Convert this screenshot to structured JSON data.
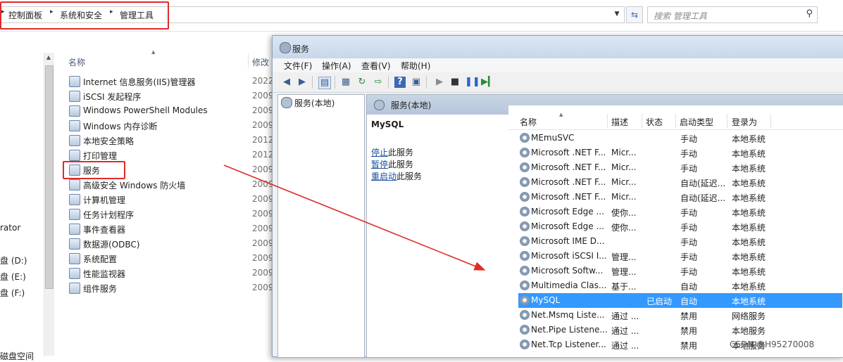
{
  "explorer": {
    "breadcrumbs": [
      "控制面板",
      "系统和安全",
      "管理工具"
    ],
    "search_placeholder": "搜索 管理工具",
    "left_nav": [
      "rator",
      "盘 (D:)",
      "盘 (E:)",
      "盘 (F:)",
      "磁盘空间"
    ],
    "columns": {
      "name": "名称",
      "modified": "修改"
    },
    "files": [
      {
        "name": "Internet 信息服务(IIS)管理器",
        "date": "2022"
      },
      {
        "name": "iSCSI 发起程序",
        "date": "2009"
      },
      {
        "name": "Windows PowerShell Modules",
        "date": "2009"
      },
      {
        "name": "Windows 内存诊断",
        "date": "2009"
      },
      {
        "name": "本地安全策略",
        "date": "2012"
      },
      {
        "name": "打印管理",
        "date": "2012"
      },
      {
        "name": "服务",
        "date": "2009"
      },
      {
        "name": "高级安全 Windows 防火墙",
        "date": "2009"
      },
      {
        "name": "计算机管理",
        "date": "2009"
      },
      {
        "name": "任务计划程序",
        "date": "2009"
      },
      {
        "name": "事件查看器",
        "date": "2009"
      },
      {
        "name": "数据源(ODBC)",
        "date": "2009"
      },
      {
        "name": "系统配置",
        "date": "2009"
      },
      {
        "name": "性能监视器",
        "date": "2009"
      },
      {
        "name": "组件服务",
        "date": "2009"
      }
    ]
  },
  "services_window": {
    "title": "服务",
    "menu": [
      "文件(F)",
      "操作(A)",
      "查看(V)",
      "帮助(H)"
    ],
    "tree_item": "服务(本地)",
    "pane_title": "服务(本地)",
    "selected_service": "MySQL",
    "actions": [
      {
        "link": "停止",
        "rest": "此服务"
      },
      {
        "link": "暂停",
        "rest": "此服务"
      },
      {
        "link": "重启动",
        "rest": "此服务"
      }
    ],
    "columns": {
      "name": "名称",
      "desc": "描述",
      "status": "状态",
      "startup": "启动类型",
      "logon": "登录为"
    },
    "rows": [
      {
        "name": "MEmuSVC",
        "desc": "",
        "status": "",
        "startup": "手动",
        "logon": "本地系统"
      },
      {
        "name": "Microsoft .NET F...",
        "desc": "Micr...",
        "status": "",
        "startup": "手动",
        "logon": "本地系统"
      },
      {
        "name": "Microsoft .NET F...",
        "desc": "Micr...",
        "status": "",
        "startup": "手动",
        "logon": "本地系统"
      },
      {
        "name": "Microsoft .NET F...",
        "desc": "Micr...",
        "status": "",
        "startup": "自动(延迟...",
        "logon": "本地系统"
      },
      {
        "name": "Microsoft .NET F...",
        "desc": "Micr...",
        "status": "",
        "startup": "自动(延迟...",
        "logon": "本地系统"
      },
      {
        "name": "Microsoft Edge ...",
        "desc": "使你...",
        "status": "",
        "startup": "手动",
        "logon": "本地系统"
      },
      {
        "name": "Microsoft Edge ...",
        "desc": "使你...",
        "status": "",
        "startup": "手动",
        "logon": "本地系统"
      },
      {
        "name": "Microsoft IME D...",
        "desc": "",
        "status": "",
        "startup": "手动",
        "logon": "本地系统"
      },
      {
        "name": "Microsoft iSCSI I...",
        "desc": "管理...",
        "status": "",
        "startup": "手动",
        "logon": "本地系统"
      },
      {
        "name": "Microsoft Softw...",
        "desc": "管理...",
        "status": "",
        "startup": "手动",
        "logon": "本地系统"
      },
      {
        "name": "Multimedia Clas...",
        "desc": "基于...",
        "status": "",
        "startup": "自动",
        "logon": "本地系统"
      },
      {
        "name": "MySQL",
        "desc": "",
        "status": "已启动",
        "startup": "自动",
        "logon": "本地系统"
      },
      {
        "name": "Net.Msmq Liste...",
        "desc": "通过 ...",
        "status": "",
        "startup": "禁用",
        "logon": "网络服务"
      },
      {
        "name": "Net.Pipe Listene...",
        "desc": "通过 ...",
        "status": "",
        "startup": "禁用",
        "logon": "本地服务"
      },
      {
        "name": "Net.Tcp Listener...",
        "desc": "通过 ...",
        "status": "",
        "startup": "禁用",
        "logon": "本地服务"
      }
    ]
  },
  "watermark": "CSDN @H95270008",
  "colors": {
    "highlight": "#3399ff",
    "annotation": "#e02a2a",
    "link": "#1a4fa0"
  }
}
